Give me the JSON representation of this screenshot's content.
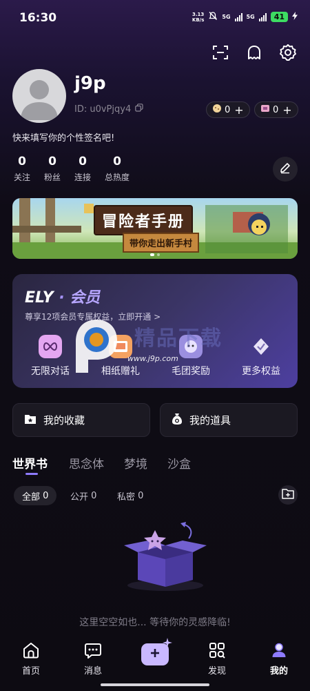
{
  "status_bar": {
    "time": "16:30",
    "speed_value": "3.13",
    "speed_unit": "KB/s",
    "net1": "5G",
    "net2": "5G",
    "battery": "41"
  },
  "profile": {
    "username": "j9p",
    "user_id": "ID: u0vPjqy4",
    "bio": "快来填写你的个性签名吧!",
    "currency_1": "0",
    "currency_2": "0",
    "stats": [
      {
        "value": "0",
        "label": "关注"
      },
      {
        "value": "0",
        "label": "粉丝"
      },
      {
        "value": "0",
        "label": "连接"
      },
      {
        "value": "0",
        "label": "总热度"
      }
    ]
  },
  "banner": {
    "title": "冒险者手册",
    "subtitle": "带你走出新手村"
  },
  "vip": {
    "brand": "ELY",
    "separator": "·",
    "member": "会员",
    "subtitle": "尊享12项会员专属权益，立即开通",
    "chevron": ">",
    "benefits": [
      {
        "label": "无限对话",
        "icon": "infinity-icon"
      },
      {
        "label": "相纸赠礼",
        "icon": "photo-gift-icon"
      },
      {
        "label": "毛团奖励",
        "icon": "furball-reward-icon"
      },
      {
        "label": "更多权益",
        "icon": "medal-icon"
      }
    ]
  },
  "watermark": {
    "text": "精品下载",
    "url": "www.j9p.com"
  },
  "shortcuts": {
    "favorites": "我的收藏",
    "items": "我的道具"
  },
  "tabs": [
    {
      "label": "世界书",
      "active": true
    },
    {
      "label": "思念体",
      "active": false
    },
    {
      "label": "梦境",
      "active": false
    },
    {
      "label": "沙盒",
      "active": false
    }
  ],
  "filters": [
    {
      "label": "全部",
      "count": "0",
      "active": true
    },
    {
      "label": "公开",
      "count": "0",
      "active": false
    },
    {
      "label": "私密",
      "count": "0",
      "active": false
    }
  ],
  "empty_state": {
    "message": "这里空空如也... 等待你的灵感降临!"
  },
  "bottom_nav": [
    {
      "label": "首页",
      "icon": "home-icon"
    },
    {
      "label": "消息",
      "icon": "message-icon"
    },
    {
      "label": "发现",
      "icon": "discover-icon"
    },
    {
      "label": "我的",
      "icon": "profile-icon",
      "active": true
    }
  ],
  "colors": {
    "accent": "#8e7bff",
    "create_button": "#c9b8ff",
    "battery": "#3ddc62"
  }
}
